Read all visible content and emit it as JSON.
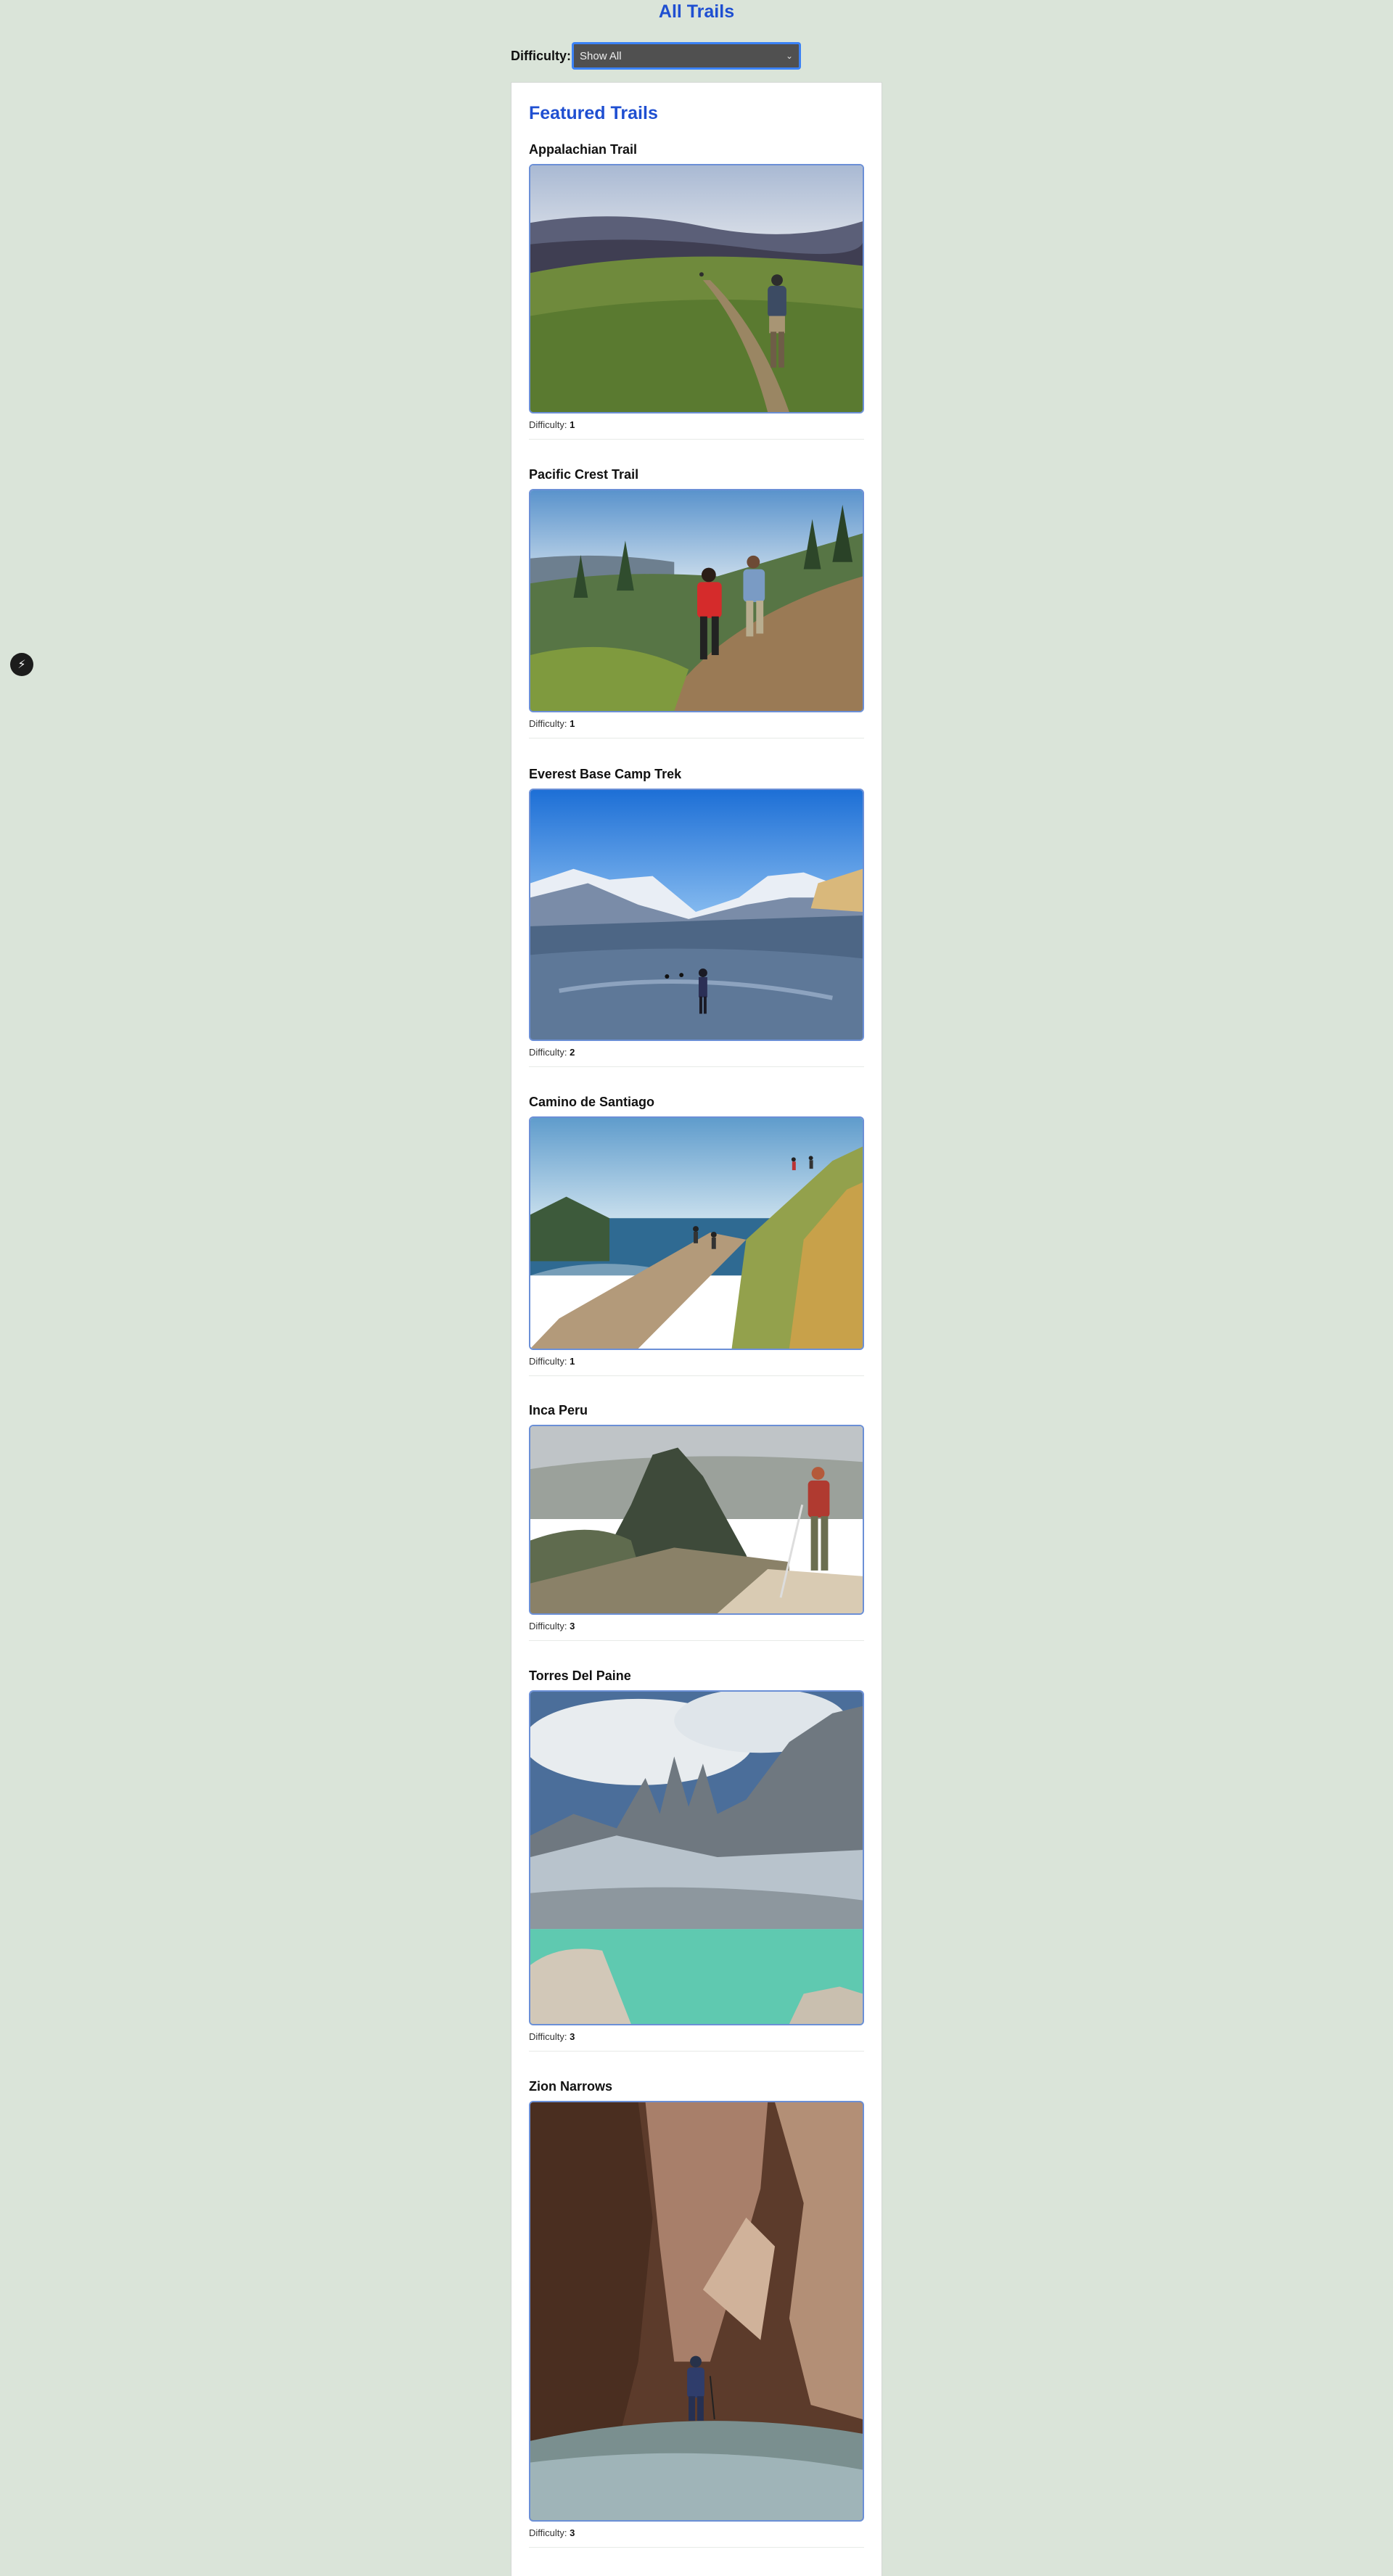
{
  "page": {
    "title": "All Trails"
  },
  "filter": {
    "label": "Difficulty:",
    "selected": "Show All"
  },
  "featured": {
    "heading": "Featured Trails"
  },
  "trails": [
    {
      "name": "Appalachian Trail",
      "difficulty_label": "Difficulty:",
      "difficulty": "1",
      "image": "mountain-meadow-hikers"
    },
    {
      "name": "Pacific Crest Trail",
      "difficulty_label": "Difficulty:",
      "difficulty": "1",
      "image": "forest-ridge-hikers"
    },
    {
      "name": "Everest Base Camp Trek",
      "difficulty_label": "Difficulty:",
      "difficulty": "2",
      "image": "glacier-valley-hikers"
    },
    {
      "name": "Camino de Santiago",
      "difficulty_label": "Difficulty:",
      "difficulty": "1",
      "image": "coastal-cliff-path"
    },
    {
      "name": "Inca Peru",
      "difficulty_label": "Difficulty:",
      "difficulty": "3",
      "image": "machu-picchu-hiker"
    },
    {
      "name": "Torres Del Paine",
      "difficulty_label": "Difficulty:",
      "difficulty": "3",
      "image": "granite-towers-lake"
    },
    {
      "name": "Zion Narrows",
      "difficulty_label": "Difficulty:",
      "difficulty": "3",
      "image": "slot-canyon-river"
    }
  ],
  "colors": {
    "accent": "#1f4fd1",
    "background": "#dae4d9"
  }
}
